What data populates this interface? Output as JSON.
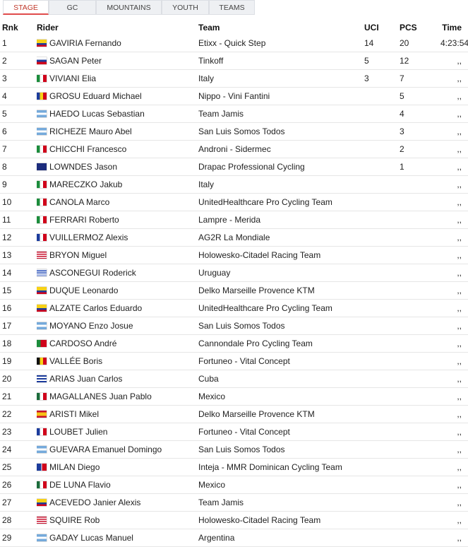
{
  "tabs": [
    {
      "label": "STAGE",
      "active": true
    },
    {
      "label": "GC",
      "active": false
    },
    {
      "label": "MOUNTAINS",
      "active": false
    },
    {
      "label": "YOUTH",
      "active": false
    },
    {
      "label": "TEAMS",
      "active": false
    }
  ],
  "headers": {
    "rnk": "Rnk",
    "rider": "Rider",
    "team": "Team",
    "uci": "UCI",
    "pcs": "PCS",
    "time": "Time"
  },
  "rows": [
    {
      "rnk": "1",
      "flag": "col",
      "rider": "GAVIRIA Fernando",
      "team": "Etixx - Quick Step",
      "uci": "14",
      "pcs": "20",
      "time": "4:23:54"
    },
    {
      "rnk": "2",
      "flag": "svk",
      "rider": "SAGAN Peter",
      "team": "Tinkoff",
      "uci": "5",
      "pcs": "12",
      "time": ",,"
    },
    {
      "rnk": "3",
      "flag": "ita",
      "rider": "VIVIANI Elia",
      "team": "Italy",
      "uci": "3",
      "pcs": "7",
      "time": ",,"
    },
    {
      "rnk": "4",
      "flag": "rom",
      "rider": "GROSU Eduard Michael",
      "team": "Nippo - Vini Fantini",
      "uci": "",
      "pcs": "5",
      "time": ",,"
    },
    {
      "rnk": "5",
      "flag": "arg",
      "rider": "HAEDO Lucas Sebastian",
      "team": "Team Jamis",
      "uci": "",
      "pcs": "4",
      "time": ",,"
    },
    {
      "rnk": "6",
      "flag": "arg",
      "rider": "RICHEZE Mauro Abel",
      "team": "San Luis Somos Todos",
      "uci": "",
      "pcs": "3",
      "time": ",,"
    },
    {
      "rnk": "7",
      "flag": "ita",
      "rider": "CHICCHI Francesco",
      "team": "Androni - Sidermec",
      "uci": "",
      "pcs": "2",
      "time": ",,"
    },
    {
      "rnk": "8",
      "flag": "aus",
      "rider": "LOWNDES Jason",
      "team": "Drapac Professional Cycling",
      "uci": "",
      "pcs": "1",
      "time": ",,"
    },
    {
      "rnk": "9",
      "flag": "ita",
      "rider": "MARECZKO Jakub",
      "team": "Italy",
      "uci": "",
      "pcs": "",
      "time": ",,"
    },
    {
      "rnk": "10",
      "flag": "ita",
      "rider": "CANOLA Marco",
      "team": "UnitedHealthcare Pro Cycling Team",
      "uci": "",
      "pcs": "",
      "time": ",,"
    },
    {
      "rnk": "11",
      "flag": "ita",
      "rider": "FERRARI Roberto",
      "team": "Lampre - Merida",
      "uci": "",
      "pcs": "",
      "time": ",,"
    },
    {
      "rnk": "12",
      "flag": "fra",
      "rider": "VUILLERMOZ Alexis",
      "team": "AG2R La Mondiale",
      "uci": "",
      "pcs": "",
      "time": ",,"
    },
    {
      "rnk": "13",
      "flag": "usa",
      "rider": "BRYON Miguel",
      "team": "Holowesko-Citadel Racing Team",
      "uci": "",
      "pcs": "",
      "time": ",,"
    },
    {
      "rnk": "14",
      "flag": "uru",
      "rider": "ASCONEGUI Roderick",
      "team": "Uruguay",
      "uci": "",
      "pcs": "",
      "time": ",,"
    },
    {
      "rnk": "15",
      "flag": "col",
      "rider": "DUQUE Leonardo",
      "team": "Delko Marseille Provence KTM",
      "uci": "",
      "pcs": "",
      "time": ",,"
    },
    {
      "rnk": "16",
      "flag": "col",
      "rider": "ALZATE Carlos Eduardo",
      "team": "UnitedHealthcare Pro Cycling Team",
      "uci": "",
      "pcs": "",
      "time": ",,"
    },
    {
      "rnk": "17",
      "flag": "arg",
      "rider": "MOYANO Enzo Josue",
      "team": "San Luis Somos Todos",
      "uci": "",
      "pcs": "",
      "time": ",,"
    },
    {
      "rnk": "18",
      "flag": "por",
      "rider": "CARDOSO André",
      "team": "Cannondale Pro Cycling Team",
      "uci": "",
      "pcs": "",
      "time": ",,"
    },
    {
      "rnk": "19",
      "flag": "bel",
      "rider": "VALLÉE Boris",
      "team": "Fortuneo - Vital Concept",
      "uci": "",
      "pcs": "",
      "time": ",,"
    },
    {
      "rnk": "20",
      "flag": "cub",
      "rider": "ARIAS Juan Carlos",
      "team": "Cuba",
      "uci": "",
      "pcs": "",
      "time": ",,"
    },
    {
      "rnk": "21",
      "flag": "mex",
      "rider": "MAGALLANES Juan Pablo",
      "team": "Mexico",
      "uci": "",
      "pcs": "",
      "time": ",,"
    },
    {
      "rnk": "22",
      "flag": "esp",
      "rider": "ARISTI Mikel",
      "team": "Delko Marseille Provence KTM",
      "uci": "",
      "pcs": "",
      "time": ",,"
    },
    {
      "rnk": "23",
      "flag": "fra",
      "rider": "LOUBET Julien",
      "team": "Fortuneo - Vital Concept",
      "uci": "",
      "pcs": "",
      "time": ",,"
    },
    {
      "rnk": "24",
      "flag": "arg",
      "rider": "GUEVARA Emanuel Domingo",
      "team": "San Luis Somos Todos",
      "uci": "",
      "pcs": "",
      "time": ",,"
    },
    {
      "rnk": "25",
      "flag": "dom",
      "rider": "MILAN Diego",
      "team": "Inteja - MMR Dominican Cycling Team",
      "uci": "",
      "pcs": "",
      "time": ",,"
    },
    {
      "rnk": "26",
      "flag": "mex",
      "rider": "DE LUNA Flavio",
      "team": "Mexico",
      "uci": "",
      "pcs": "",
      "time": ",,"
    },
    {
      "rnk": "27",
      "flag": "ecu",
      "rider": "ACEVEDO Janier Alexis",
      "team": "Team Jamis",
      "uci": "",
      "pcs": "",
      "time": ",,"
    },
    {
      "rnk": "28",
      "flag": "usa",
      "rider": "SQUIRE Rob",
      "team": "Holowesko-Citadel Racing Team",
      "uci": "",
      "pcs": "",
      "time": ",,"
    },
    {
      "rnk": "29",
      "flag": "arg",
      "rider": "GADAY Lucas Manuel",
      "team": "Argentina",
      "uci": "",
      "pcs": "",
      "time": ",,"
    }
  ]
}
